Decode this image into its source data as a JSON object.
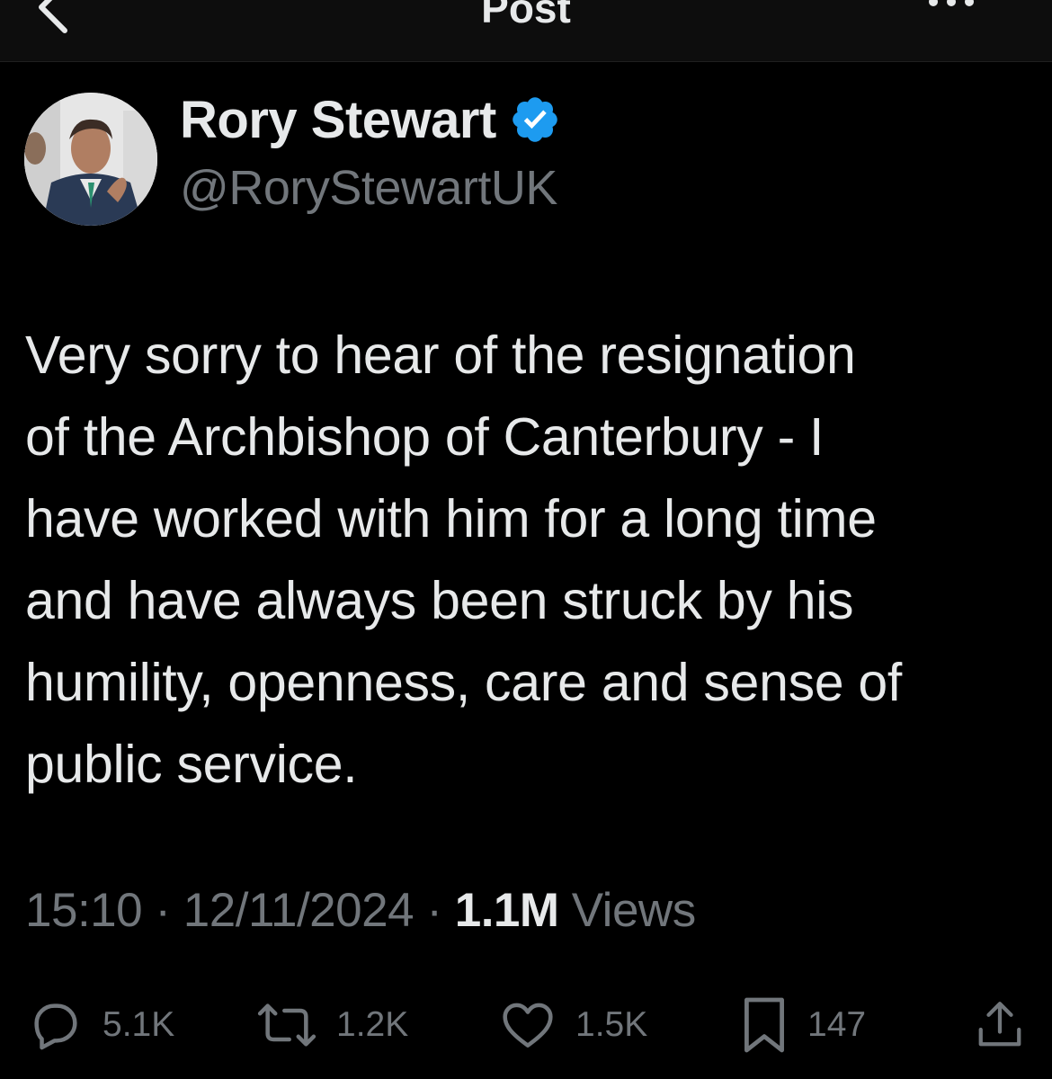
{
  "header": {
    "title": "Post",
    "back_icon": "arrow-left-icon",
    "more_icon": "more-horizontal-icon"
  },
  "author": {
    "display_name": "Rory Stewart",
    "handle": "@RoryStewartUK",
    "verified": true,
    "verified_color": "#1d9bf0"
  },
  "tweet": {
    "lines": [
      "Very sorry to hear of the resignation",
      "of the Archbishop of Canterbury - I",
      "have worked with him for a long time",
      "and have always been struck by his",
      "humility, openness, care and sense of",
      "public service."
    ]
  },
  "meta": {
    "time": "15:10",
    "separator": "·",
    "date": "12/11/2024",
    "views_count": "1.1M",
    "views_label": "Views"
  },
  "actions": {
    "replies": "5.1K",
    "reposts": "1.2K",
    "likes": "1.5K",
    "bookmarks": "147"
  },
  "colors": {
    "background": "#000000",
    "text": "#e7e9ea",
    "secondary_text": "#71767b",
    "accent": "#1d9bf0"
  }
}
